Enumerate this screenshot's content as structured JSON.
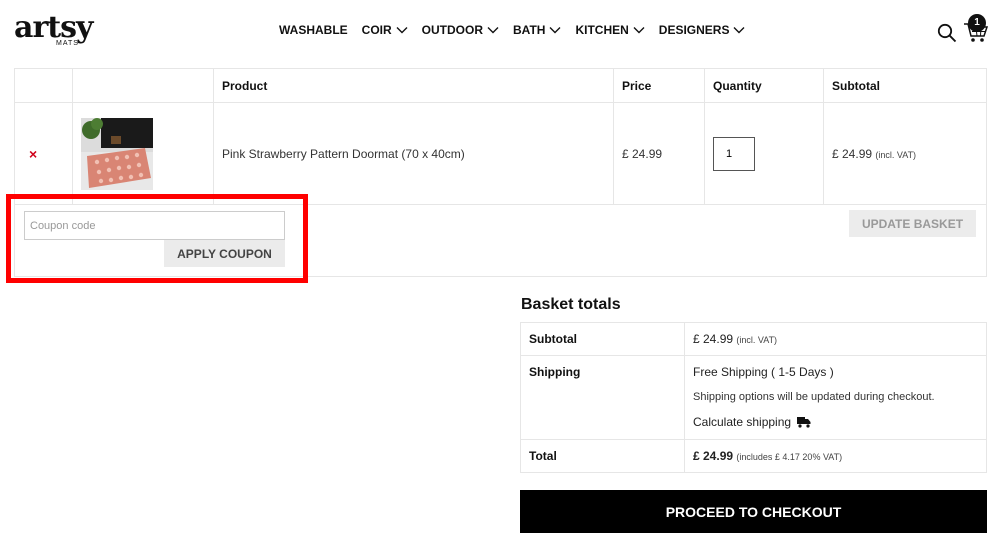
{
  "brand": {
    "logo_main": "artsy",
    "logo_sub": "MATS"
  },
  "nav": {
    "washable": "WASHABLE",
    "coir": "COIR",
    "outdoor": "OUTDOOR",
    "bath": "BATH",
    "kitchen": "KITCHEN",
    "designers": "DESIGNERS"
  },
  "cart_count": "1",
  "cart_table": {
    "headers": {
      "product": "Product",
      "price": "Price",
      "quantity": "Quantity",
      "subtotal": "Subtotal"
    },
    "item": {
      "remove": "×",
      "name": "Pink Strawberry Pattern Doormat (70 x 40cm)",
      "price": "£ 24.99",
      "quantity": "1",
      "subtotal": "£ 24.99",
      "subtotal_note": "(incl. VAT)"
    }
  },
  "coupon": {
    "placeholder": "Coupon code",
    "apply_label": "APPLY COUPON"
  },
  "update_label": "UPDATE BASKET",
  "totals": {
    "title": "Basket totals",
    "subtotal_label": "Subtotal",
    "subtotal_value": "£ 24.99",
    "subtotal_note": "(incl. VAT)",
    "shipping_label": "Shipping",
    "shipping_method": "Free Shipping ( 1-5 Days )",
    "shipping_note": "Shipping options will be updated during checkout.",
    "calculate_label": "Calculate shipping",
    "total_label": "Total",
    "total_value": "£ 24.99",
    "total_note": "(includes £ 4.17 20% VAT)"
  },
  "checkout_label": "PROCEED TO CHECKOUT"
}
